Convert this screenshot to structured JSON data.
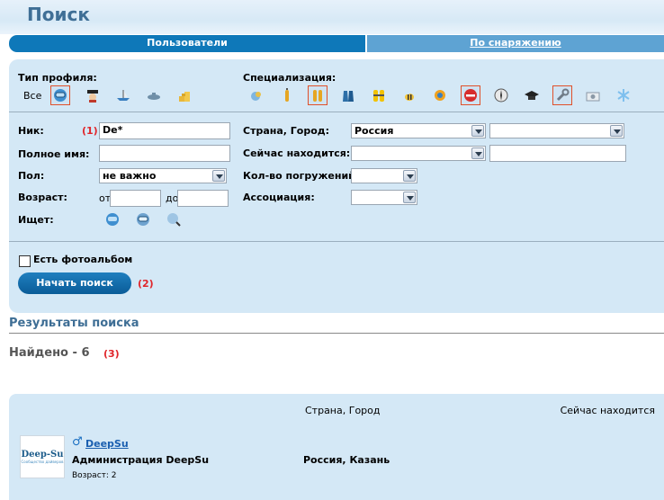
{
  "page": {
    "title": "Поиск"
  },
  "tabs": [
    {
      "label": "Пользователи",
      "active": true
    },
    {
      "label": "По снаряжению",
      "active": false
    }
  ],
  "filters": {
    "profile_type_label": "Тип профиля:",
    "profile_all_label": "Все",
    "specialization_label": "Специализация:",
    "profile_icons": [
      "diver-mask-icon",
      "captain-icon",
      "boat-icon",
      "submarine-icon",
      "coins-icon"
    ],
    "specialization_icons": [
      "fish-icon",
      "tank-icon",
      "twin-tanks-icon",
      "fins-icon",
      "yellow-tanks-icon",
      "bee-icon",
      "gear-icon",
      "no-entry-icon",
      "compass-icon",
      "graduation-cap-icon",
      "wrench-icon",
      "camera-icon",
      "snowflake-icon"
    ]
  },
  "fields": {
    "nick": {
      "label": "Ник:",
      "marker": "(1)",
      "value": "De*"
    },
    "full_name": {
      "label": "Полное имя:",
      "value": ""
    },
    "gender": {
      "label": "Пол:",
      "value": "не важно"
    },
    "age": {
      "label": "Возраст:",
      "from_label": "от",
      "to_label": "до",
      "from": "",
      "to": ""
    },
    "seeks": {
      "label": "Ищет:",
      "icons": [
        "diver-seek-icon",
        "diver-face-icon",
        "diver-search-icon"
      ]
    },
    "country_city": {
      "label": "Страна, Город:",
      "country": "Россия",
      "city": ""
    },
    "location_now": {
      "label": "Сейчас находится:",
      "value": ""
    },
    "dives_count": {
      "label": "Кол-во погружений:",
      "value": ""
    },
    "association": {
      "label": "Ассоциация:",
      "value": ""
    }
  },
  "photo_album": {
    "label": "Есть фотоальбом",
    "checked": false
  },
  "search_button": {
    "label": "Начать поиск",
    "marker": "(2)"
  },
  "results": {
    "title": "Результаты поиска",
    "found_label": "Найдено - 6",
    "found_marker": "(3)",
    "columns": [
      "Страна, Город",
      "Сейчас находится"
    ],
    "rows": [
      {
        "logo_text": "Deep-Su",
        "logo_sub": "Сообщество дайверов",
        "username": "DeepSu",
        "gender_symbol": "♂",
        "full_name": "Администрация DeepSu",
        "age_label": "Возраст: 2",
        "country_city": "Россия, Казань"
      }
    ]
  }
}
